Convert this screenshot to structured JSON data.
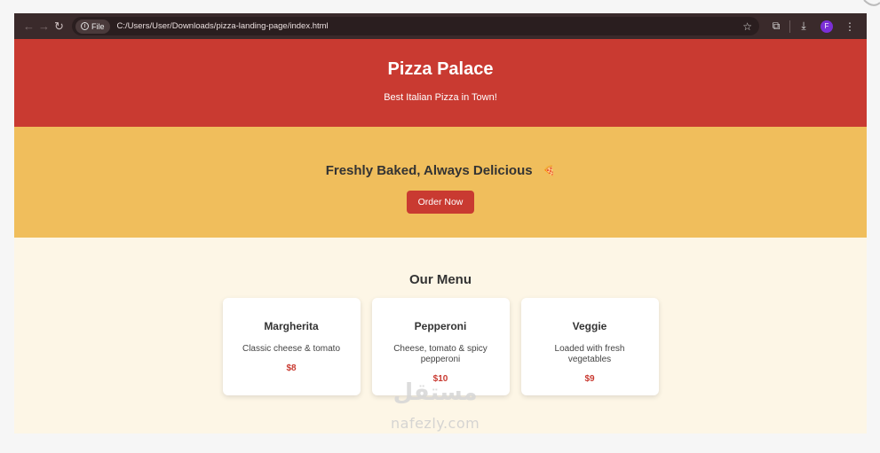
{
  "browser": {
    "file_chip": "File",
    "url": "C:/Users/User/Downloads/pizza-landing-page/index.html",
    "profile_initial": "F"
  },
  "header": {
    "title": "Pizza Palace",
    "tagline": "Best Italian Pizza in Town!"
  },
  "hero": {
    "heading": "Freshly Baked, Always Delicious",
    "emoji": "🍕",
    "button_label": "Order Now"
  },
  "menu": {
    "title": "Our Menu",
    "items": [
      {
        "name": "Margherita",
        "description": "Classic cheese & tomato",
        "price": "$8"
      },
      {
        "name": "Pepperoni",
        "description": "Cheese, tomato & spicy pepperoni",
        "price": "$10"
      },
      {
        "name": "Veggie",
        "description": "Loaded with fresh vegetables",
        "price": "$9"
      }
    ]
  },
  "watermark": {
    "arabic": "مستقل",
    "latin": "nafezly.com"
  },
  "colors": {
    "header_bg": "#c93a31",
    "hero_bg": "#f0be5c",
    "menu_bg": "#fdf6e6",
    "price": "#c93a31"
  }
}
